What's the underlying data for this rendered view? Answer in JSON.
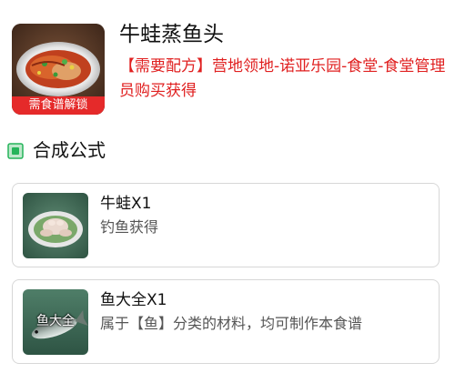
{
  "recipe": {
    "title": "牛蛙蒸鱼头",
    "lock_badge": "需食谱解锁",
    "source": "【需要配方】营地领地-诺亚乐园-食堂-食堂管理员购买获得",
    "image_icon": "steamed-fish-head-dish"
  },
  "section": {
    "title": "合成公式",
    "icon": "green-square-icon"
  },
  "ingredients": [
    {
      "name": "牛蛙X1",
      "description": "钓鱼获得",
      "icon": "bullfrog-on-plate"
    },
    {
      "name": "鱼大全X1",
      "description": "属于【鱼】分类的材料，均可制作本食谱",
      "thumb_caption": "鱼大全",
      "icon": "fish"
    }
  ],
  "colors": {
    "accent_red": "#e02020",
    "lock_badge_red": "#e52a2a",
    "section_icon_green": "#25b45a",
    "card_border": "#d7d7d7"
  }
}
